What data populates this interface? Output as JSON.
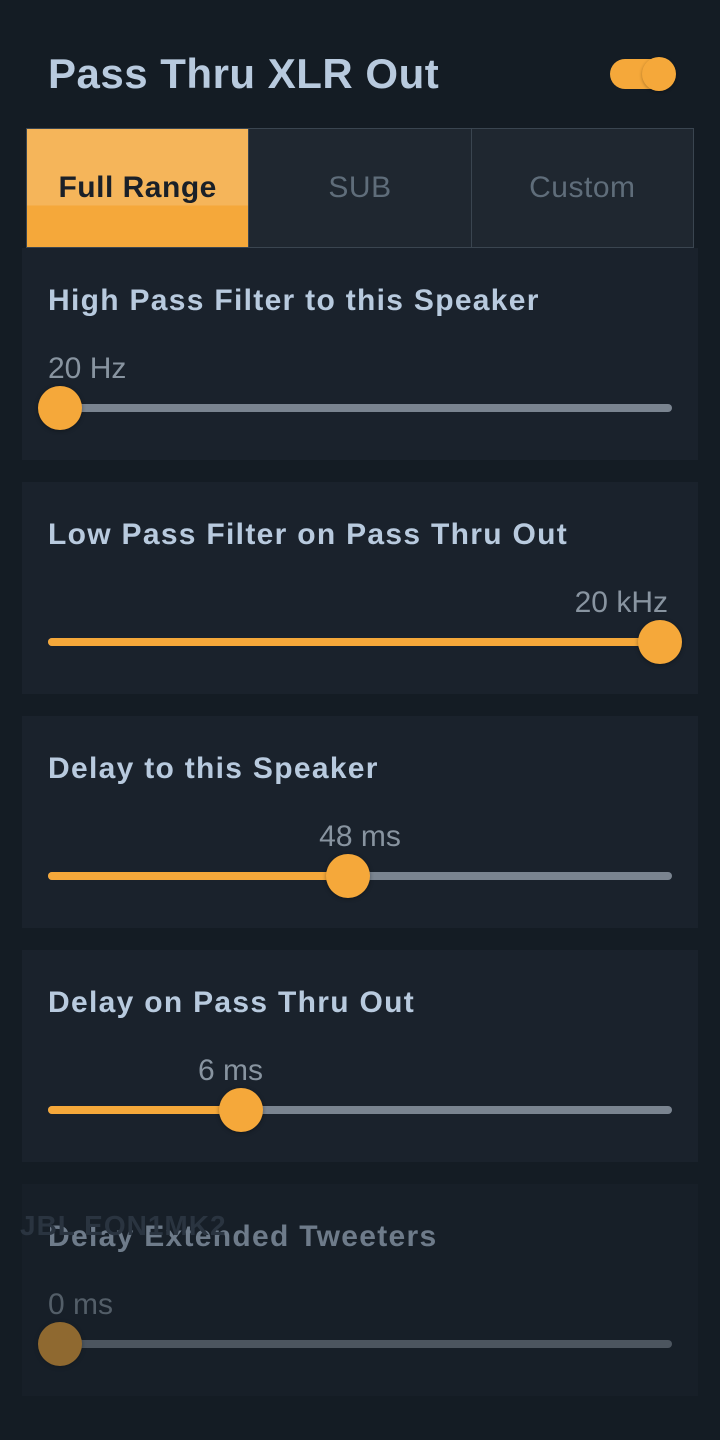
{
  "header": {
    "title": "Pass Thru XLR Out",
    "toggle_on": true
  },
  "tabs": {
    "items": [
      {
        "label": "Full Range",
        "active": true
      },
      {
        "label": "SUB",
        "active": false
      },
      {
        "label": "Custom",
        "active": false
      }
    ]
  },
  "sliders": [
    {
      "label": "High Pass Filter to this Speaker",
      "value_text": "20 Hz",
      "value_align": "left",
      "fill_percent": 2,
      "thumb_percent": 2,
      "dimmed": false
    },
    {
      "label": "Low Pass Filter on Pass Thru Out",
      "value_text": "20 kHz",
      "value_align": "right",
      "fill_percent": 100,
      "thumb_percent": 98,
      "dimmed": false
    },
    {
      "label": "Delay to this Speaker",
      "value_text": "48 ms",
      "value_align": "center",
      "fill_percent": 48,
      "thumb_percent": 48,
      "dimmed": false
    },
    {
      "label": "Delay on Pass Thru Out",
      "value_text": "6 ms",
      "value_align": "center-offset-left",
      "fill_percent": 31,
      "thumb_percent": 31,
      "dimmed": false
    },
    {
      "label": "Delay Extended Tweeters",
      "value_text": "0 ms",
      "value_align": "left",
      "fill_percent": 2,
      "thumb_percent": 2,
      "dimmed": true
    }
  ],
  "ghost": {
    "device": "JBL EON1MK2"
  }
}
